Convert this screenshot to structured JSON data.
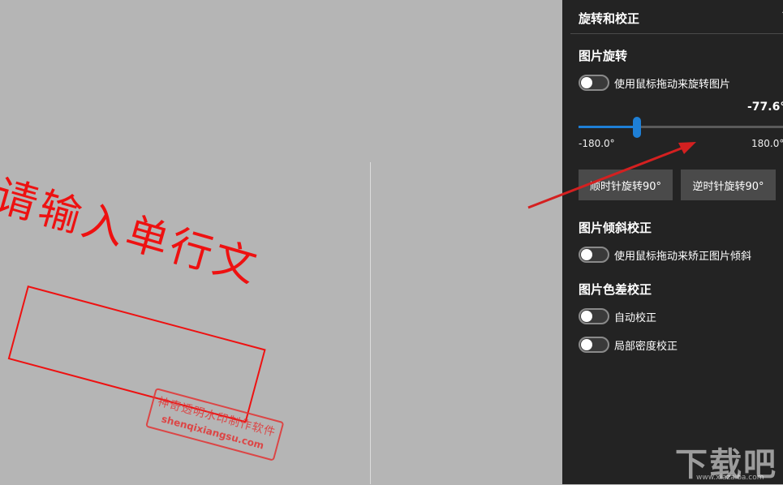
{
  "canvas": {
    "stamp_text": "请输入单行文",
    "watermark": {
      "line1": "神奇透明水印制作软件",
      "line2": "shenqixiangsu.com"
    }
  },
  "panel": {
    "title": "旋转和校正",
    "chevron_icon": "chevron-up-icon",
    "rotation": {
      "section_title": "图片旋转",
      "mouse_toggle_label": "使用鼠标拖动来旋转图片",
      "mouse_toggle_on": false,
      "value_label": "-77.6°",
      "value": -77.6,
      "min": -180.0,
      "max": 180.0,
      "min_label": "-180.0°",
      "max_label": "180.0°",
      "clockwise_button": "顺时针旋转90°",
      "counterclockwise_button": "逆时针旋转90°"
    },
    "skew": {
      "section_title": "图片倾斜校正",
      "mouse_toggle_label": "使用鼠标拖动来矫正图片倾斜",
      "mouse_toggle_on": false
    },
    "color": {
      "section_title": "图片色差校正",
      "auto_label": "自动校正",
      "auto_on": false,
      "local_label": "局部密度校正",
      "local_on": false
    }
  },
  "site_logo": {
    "text": "下载吧",
    "url": "www.xiazaiba.com"
  },
  "colors": {
    "accent": "#1e7fd6",
    "panel_bg": "#232323",
    "canvas_bg": "#b5b5b5",
    "stamp_red": "#ee1111",
    "arrow_red": "#d42020"
  }
}
